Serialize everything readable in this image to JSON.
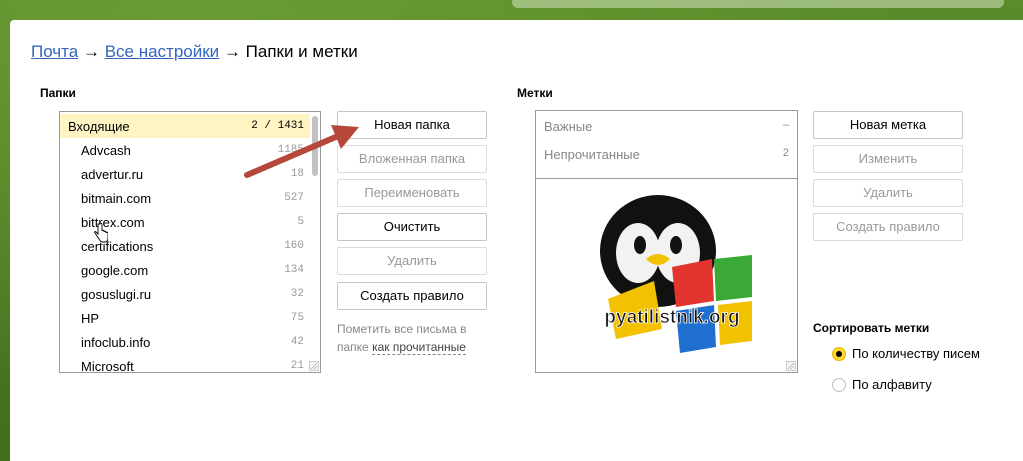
{
  "breadcrumb": {
    "mail": "Почта",
    "arrow1": "→",
    "all_settings": "Все настройки",
    "arrow2": "→",
    "current": "Папки и метки"
  },
  "folders": {
    "title": "Папки",
    "items": [
      {
        "name": "Входящие",
        "count": "2 / 1431"
      },
      {
        "name": "Advcash",
        "count": "1185"
      },
      {
        "name": "advertur.ru",
        "count": "18"
      },
      {
        "name": "bitmain.com",
        "count": "527"
      },
      {
        "name": "bittrex.com",
        "count": "5"
      },
      {
        "name": "certifications",
        "count": "160"
      },
      {
        "name": "google.com",
        "count": "134"
      },
      {
        "name": "gosuslugi.ru",
        "count": "32"
      },
      {
        "name": "HP",
        "count": "75"
      },
      {
        "name": "infoclub.info",
        "count": "42"
      },
      {
        "name": "Microsoft",
        "count": "21"
      }
    ],
    "buttons": {
      "new_folder": "Новая папка",
      "subfolder": "Вложенная папка",
      "rename": "Переименовать",
      "clear": "Очистить",
      "delete": "Удалить",
      "create_rule": "Создать правило"
    },
    "hint_text": "Пометить все письма в папке",
    "hint_link": "как прочитанные"
  },
  "labels": {
    "title": "Метки",
    "items": [
      {
        "name": "Важные",
        "count": "–"
      },
      {
        "name": "Непрочитанные",
        "count": "2"
      }
    ],
    "watermark_text": "pyatilistnik.org",
    "buttons": {
      "new_label": "Новая метка",
      "edit": "Изменить",
      "delete": "Удалить",
      "create_rule": "Создать правило"
    }
  },
  "sort": {
    "title": "Сортировать метки",
    "options": [
      {
        "label": "По количеству писем",
        "checked": true
      },
      {
        "label": "По алфавиту",
        "checked": false
      }
    ]
  },
  "colors": {
    "link": "#3366bb",
    "inbox_highlight": "#fff4c2",
    "arrow": "#b5483a",
    "radio_checked": "#ffd633"
  }
}
